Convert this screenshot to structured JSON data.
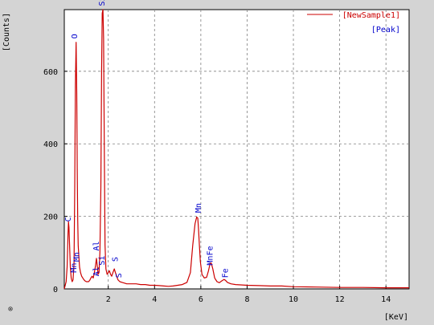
{
  "chart_data": {
    "type": "line",
    "title": "",
    "xlabel": "[KeV]",
    "ylabel": "[Counts]",
    "xlim": [
      0.1,
      15
    ],
    "ylim": [
      0,
      770
    ],
    "x_ticks": [
      2,
      4,
      6,
      8,
      10,
      12,
      14
    ],
    "y_ticks": [
      0,
      200,
      400,
      600
    ],
    "grid": true,
    "legend_position": "top-right",
    "legend": [
      {
        "label": "[NewSample1]",
        "color": "#cc0000",
        "marker": "line"
      },
      {
        "label": "[Peak]",
        "color": "#0000cc",
        "marker": "none"
      }
    ],
    "series": [
      {
        "name": "[NewSample1]",
        "color": "#cc0000",
        "x": [
          0.1,
          0.18,
          0.22,
          0.26,
          0.28,
          0.3,
          0.33,
          0.36,
          0.4,
          0.44,
          0.48,
          0.52,
          0.55,
          0.58,
          0.61,
          0.64,
          0.66,
          0.68,
          0.7,
          0.73,
          0.76,
          0.8,
          0.85,
          0.9,
          0.95,
          1.0,
          1.05,
          1.1,
          1.15,
          1.2,
          1.25,
          1.3,
          1.35,
          1.4,
          1.45,
          1.49,
          1.53,
          1.56,
          1.6,
          1.64,
          1.68,
          1.71,
          1.74,
          1.77,
          1.8,
          1.83,
          1.86,
          1.9,
          1.95,
          2.0,
          2.05,
          2.1,
          2.15,
          2.2,
          2.26,
          2.31,
          2.36,
          2.42,
          2.5,
          2.6,
          2.7,
          2.8,
          3.0,
          3.2,
          3.4,
          3.6,
          3.8,
          4.0,
          4.2,
          4.4,
          4.6,
          4.8,
          5.0,
          5.2,
          5.4,
          5.55,
          5.65,
          5.75,
          5.82,
          5.87,
          5.9,
          5.94,
          5.98,
          6.05,
          6.15,
          6.25,
          6.33,
          6.4,
          6.45,
          6.52,
          6.6,
          6.7,
          6.8,
          6.9,
          7.0,
          7.06,
          7.15,
          7.3,
          7.5,
          8.0,
          8.5,
          9.0,
          9.5,
          10.0,
          11.0,
          12.0,
          13.0,
          14.0,
          15.0
        ],
        "y": [
          0,
          20,
          60,
          150,
          185,
          170,
          120,
          60,
          30,
          20,
          25,
          70,
          280,
          560,
          680,
          540,
          330,
          190,
          120,
          90,
          60,
          45,
          35,
          30,
          25,
          22,
          20,
          20,
          20,
          24,
          30,
          35,
          30,
          45,
          65,
          84,
          60,
          40,
          45,
          100,
          280,
          600,
          760,
          770,
          690,
          380,
          120,
          55,
          40,
          45,
          50,
          40,
          35,
          45,
          55,
          45,
          35,
          25,
          20,
          18,
          16,
          14,
          14,
          14,
          12,
          12,
          10,
          10,
          9,
          8,
          7,
          8,
          10,
          12,
          18,
          45,
          120,
          180,
          198,
          195,
          165,
          120,
          75,
          40,
          30,
          32,
          50,
          70,
          72,
          55,
          30,
          20,
          17,
          22,
          26,
          24,
          18,
          14,
          12,
          10,
          9,
          8,
          8,
          6,
          5,
          4,
          4,
          3,
          3
        ]
      }
    ],
    "peak_labels": [
      {
        "label": "C",
        "x": 0.28,
        "y": 185
      },
      {
        "label": "O",
        "x": 0.56,
        "y": 690
      },
      {
        "label": "Mn",
        "x": 0.52,
        "y": 45
      },
      {
        "label": "Mn",
        "x": 0.64,
        "y": 75
      },
      {
        "label": "Al",
        "x": 1.49,
        "y": 105
      },
      {
        "label": "Al",
        "x": 1.49,
        "y": 35
      },
      {
        "label": "Si",
        "x": 1.74,
        "y": 780
      },
      {
        "label": "Si",
        "x": 1.74,
        "y": 65
      },
      {
        "label": "S",
        "x": 2.31,
        "y": 75
      },
      {
        "label": "S",
        "x": 2.46,
        "y": 30
      },
      {
        "label": "Mn",
        "x": 5.9,
        "y": 210
      },
      {
        "label": "MnFe",
        "x": 6.4,
        "y": 65
      },
      {
        "label": "Fe",
        "x": 7.06,
        "y": 30
      }
    ]
  },
  "corner_mark": "⊗"
}
